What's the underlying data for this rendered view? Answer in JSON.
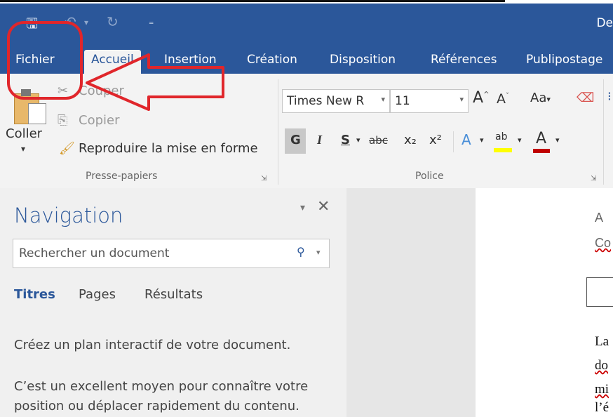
{
  "window": {
    "title_partial": "De"
  },
  "quick_access": {
    "save_icon": "save-icon",
    "undo_icon": "undo-icon",
    "redo_icon": "redo-icon",
    "customize_icon": "customize-qat-icon"
  },
  "tabs": [
    "Fichier",
    "Accueil",
    "Insertion",
    "Création",
    "Disposition",
    "Références",
    "Publipostage"
  ],
  "clipboard": {
    "paste_label": "Coller",
    "cut_label": "Couper",
    "copy_label": "Copier",
    "format_painter_label": "Reproduire la mise en forme",
    "group_label": "Presse-papiers"
  },
  "font": {
    "font_name": "Times New R",
    "font_size": "11",
    "bold": "G",
    "italic": "I",
    "underline": "S",
    "strike": "abc",
    "subscript": "x₂",
    "superscript": "x²",
    "case_label": "Aa",
    "group_label": "Police"
  },
  "navigation": {
    "title": "Navigation",
    "search_placeholder": "Rechercher un document",
    "tabs": [
      "Titres",
      "Pages",
      "Résultats"
    ],
    "hint_line1": "Créez un plan interactif de votre document.",
    "hint_line2": "C’est un excellent moyen pour connaître votre",
    "hint_line3": "position ou déplacer rapidement du contenu."
  },
  "document": {
    "line_a": "A",
    "line_co": "Co",
    "line_la": "La",
    "line_do": "do",
    "line_mi": "mi",
    "line_le": "l’é"
  },
  "colors": {
    "brand": "#2b579a",
    "annotation": "#e0262b",
    "highlight": "#ffff00",
    "font_color": "#c00000"
  }
}
